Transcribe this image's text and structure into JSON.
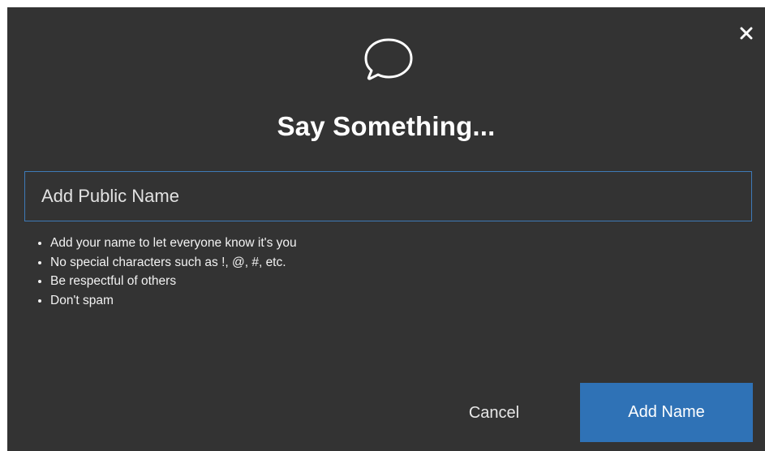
{
  "dialog": {
    "close_icon": "close-icon",
    "chat_icon": "chat-bubble-icon",
    "title": "Say Something...",
    "name_input": {
      "placeholder": "Add Public Name",
      "value": ""
    },
    "rules": [
      "Add your name to let everyone know it's you",
      "No special characters such as !, @, #, etc.",
      "Be respectful of others",
      "Don't spam"
    ],
    "cancel_label": "Cancel",
    "submit_label": "Add Name"
  },
  "colors": {
    "background": "#333333",
    "accent": "#2f72b6",
    "input_border": "#3e7ab7",
    "text": "#ffffff"
  }
}
